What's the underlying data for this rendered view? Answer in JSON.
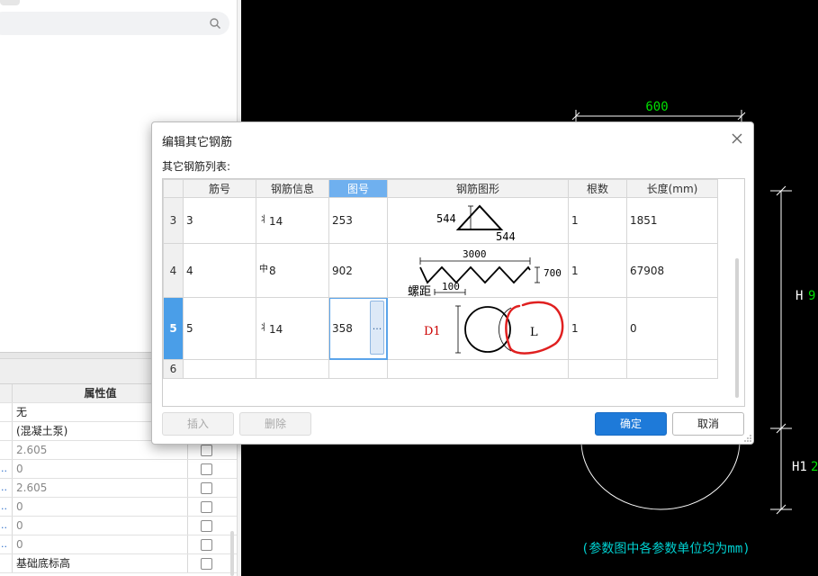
{
  "left_panel": {
    "properties": {
      "header": "属性值",
      "rows": [
        {
          "marker": "",
          "value": "无",
          "gray": false,
          "checkbox": false
        },
        {
          "marker": "",
          "value": "(混凝土泵)",
          "gray": false,
          "checkbox": false
        },
        {
          "marker": "",
          "value": "2.605",
          "gray": true,
          "checkbox": true
        },
        {
          "marker": "..",
          "value": "0",
          "gray": true,
          "checkbox": true
        },
        {
          "marker": "..",
          "value": "2.605",
          "gray": true,
          "checkbox": true
        },
        {
          "marker": "..",
          "value": "0",
          "gray": true,
          "checkbox": true
        },
        {
          "marker": "..",
          "value": "0",
          "gray": true,
          "checkbox": true
        },
        {
          "marker": "..",
          "value": "0",
          "gray": true,
          "checkbox": true
        },
        {
          "marker": "",
          "value": "基础底标高",
          "gray": false,
          "checkbox": true
        }
      ]
    }
  },
  "cad": {
    "dim_top": "600",
    "h_label": "H",
    "h_value": "9",
    "h1_label": "H1",
    "h1_value": "2",
    "note": "(参数图中各参数单位均为mm)",
    "colors": {
      "dim": "#00e000",
      "line": "#ffffff",
      "note": "#00d0d0",
      "bg": "#000000"
    }
  },
  "dialog": {
    "title": "编辑其它钢筋",
    "subtitle": "其它钢筋列表:",
    "columns": [
      "筋号",
      "钢筋信息",
      "图号",
      "钢筋图形",
      "根数",
      "长度(mm)"
    ],
    "rows": [
      {
        "row": "3",
        "jin_hao": "3",
        "info_glyph": "丬",
        "info": "14",
        "tu_hao": "253",
        "shape": "triangle",
        "count": "1",
        "length": "1851"
      },
      {
        "row": "4",
        "jin_hao": "4",
        "info_glyph": "中",
        "info": "8",
        "tu_hao": "902",
        "shape": "spiral",
        "count": "1",
        "length": "67908"
      },
      {
        "row": "5",
        "jin_hao": "5",
        "info_glyph": "丬",
        "info": "14",
        "tu_hao": "358",
        "shape": "circle",
        "count": "1",
        "length": "0"
      },
      {
        "row": "6",
        "jin_hao": "",
        "info_glyph": "",
        "info": "",
        "tu_hao": "",
        "shape": "",
        "count": "",
        "length": ""
      }
    ],
    "shape_labels": {
      "triangle_left": "544",
      "triangle_bottom": "544",
      "spiral_top": "3000",
      "spiral_right": "700",
      "spiral_bottom": "100",
      "spiral_pitch": "螺距",
      "circle_d": "D1",
      "circle_l": "L"
    },
    "ellipsis": "...",
    "buttons": {
      "insert": "插入",
      "delete": "删除",
      "ok": "确定",
      "cancel": "取消"
    },
    "selected_column": "图号",
    "active_row": "5"
  }
}
